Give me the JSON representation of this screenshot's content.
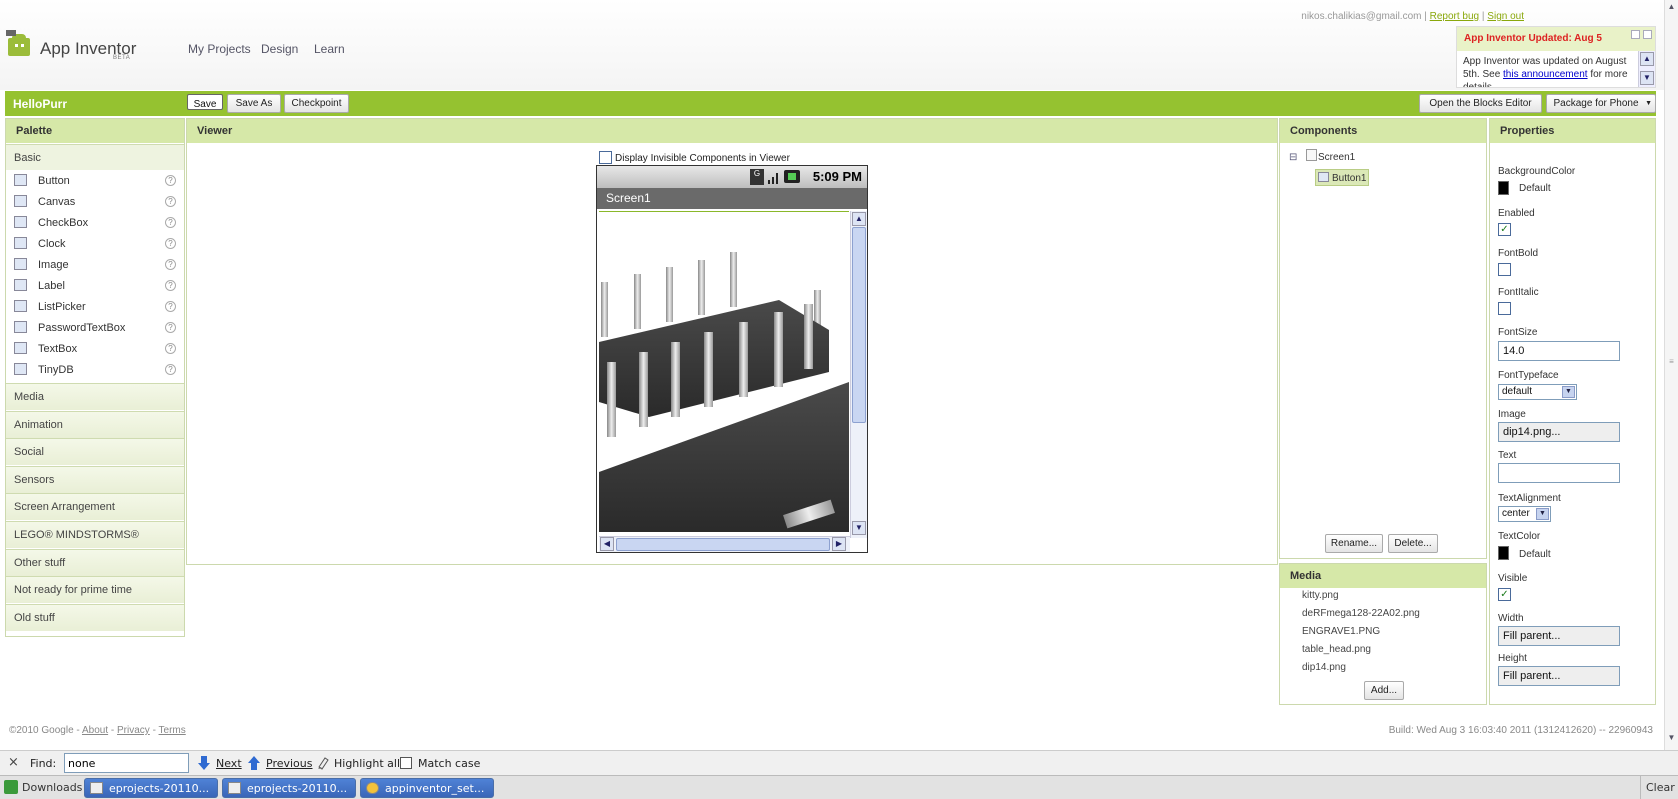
{
  "header": {
    "app_name": "App Inventor",
    "beta": "BETA",
    "nav": [
      "My Projects",
      "Design",
      "Learn"
    ],
    "user_email": "nikos.chalikias@gmail.com",
    "separator": "|",
    "report_bug": "Report bug",
    "sign_out": "Sign out"
  },
  "news": {
    "title": "App Inventor Updated: Aug 5",
    "body_pre": "App Inventor was updated on August 5th. See ",
    "link": "this announcement",
    "body_post": " for more details"
  },
  "project": {
    "name": "HelloPurr",
    "save": "Save",
    "save_as": "Save As",
    "checkpoint": "Checkpoint",
    "open_blocks": "Open the Blocks Editor",
    "package": "Package for Phone"
  },
  "palette": {
    "title": "Palette",
    "basic_title": "Basic",
    "items": [
      "Button",
      "Canvas",
      "CheckBox",
      "Clock",
      "Image",
      "Label",
      "ListPicker",
      "PasswordTextBox",
      "TextBox",
      "TinyDB"
    ],
    "help_glyph": "?",
    "sections": [
      "Media",
      "Animation",
      "Social",
      "Sensors",
      "Screen Arrangement",
      "LEGO® MINDSTORMS®",
      "Other stuff",
      "Not ready for prime time",
      "Old stuff"
    ]
  },
  "viewer": {
    "title": "Viewer",
    "invisible_label": "Display Invisible Components in Viewer",
    "phone_time": "5:09 PM",
    "screen_title": "Screen1"
  },
  "components": {
    "title": "Components",
    "tree_toggle": "⊟",
    "root": "Screen1",
    "child": "Button1",
    "rename": "Rename...",
    "delete": "Delete..."
  },
  "media": {
    "title": "Media",
    "files": [
      "kitty.png",
      "deRFmega128-22A02.png",
      "ENGRAVE1.PNG",
      "table_head.png",
      "dip14.png"
    ],
    "add": "Add..."
  },
  "properties": {
    "title": "Properties",
    "background_color_label": "BackgroundColor",
    "background_color_value": "Default",
    "enabled_label": "Enabled",
    "enabled": true,
    "fontbold_label": "FontBold",
    "fontbold": false,
    "fontitalic_label": "FontItalic",
    "fontitalic": false,
    "fontsize_label": "FontSize",
    "fontsize_value": "14.0",
    "fonttypeface_label": "FontTypeface",
    "fonttypeface_value": "default",
    "image_label": "Image",
    "image_value": "dip14.png...",
    "text_label": "Text",
    "text_value": "",
    "textalign_label": "TextAlignment",
    "textalign_value": "center",
    "textcolor_label": "TextColor",
    "textcolor_value": "Default",
    "visible_label": "Visible",
    "visible": true,
    "width_label": "Width",
    "width_value": "Fill parent...",
    "height_label": "Height",
    "height_value": "Fill parent..."
  },
  "footer": {
    "copyright": "©2010 Google",
    "sep": " - ",
    "about": "About",
    "privacy": "Privacy",
    "terms": "Terms",
    "build": "Build: Wed Aug 3 16:03:40 2011 (1312412620) -- 22960943"
  },
  "findbar": {
    "close": "×",
    "label": "Find:",
    "value": "none",
    "next": "Next",
    "previous": "Previous",
    "highlight": "Highlight all",
    "match_case": "Match case"
  },
  "taskbar": {
    "downloads": "Downloads",
    "tasks": [
      "eprojects-20110...",
      "eprojects-20110...",
      "appinventor_set..."
    ],
    "clear": "Clear"
  },
  "colors": {
    "accent_green": "#95c230",
    "panel_header": "#d6e8a8",
    "news_title_red": "#dd2222"
  }
}
